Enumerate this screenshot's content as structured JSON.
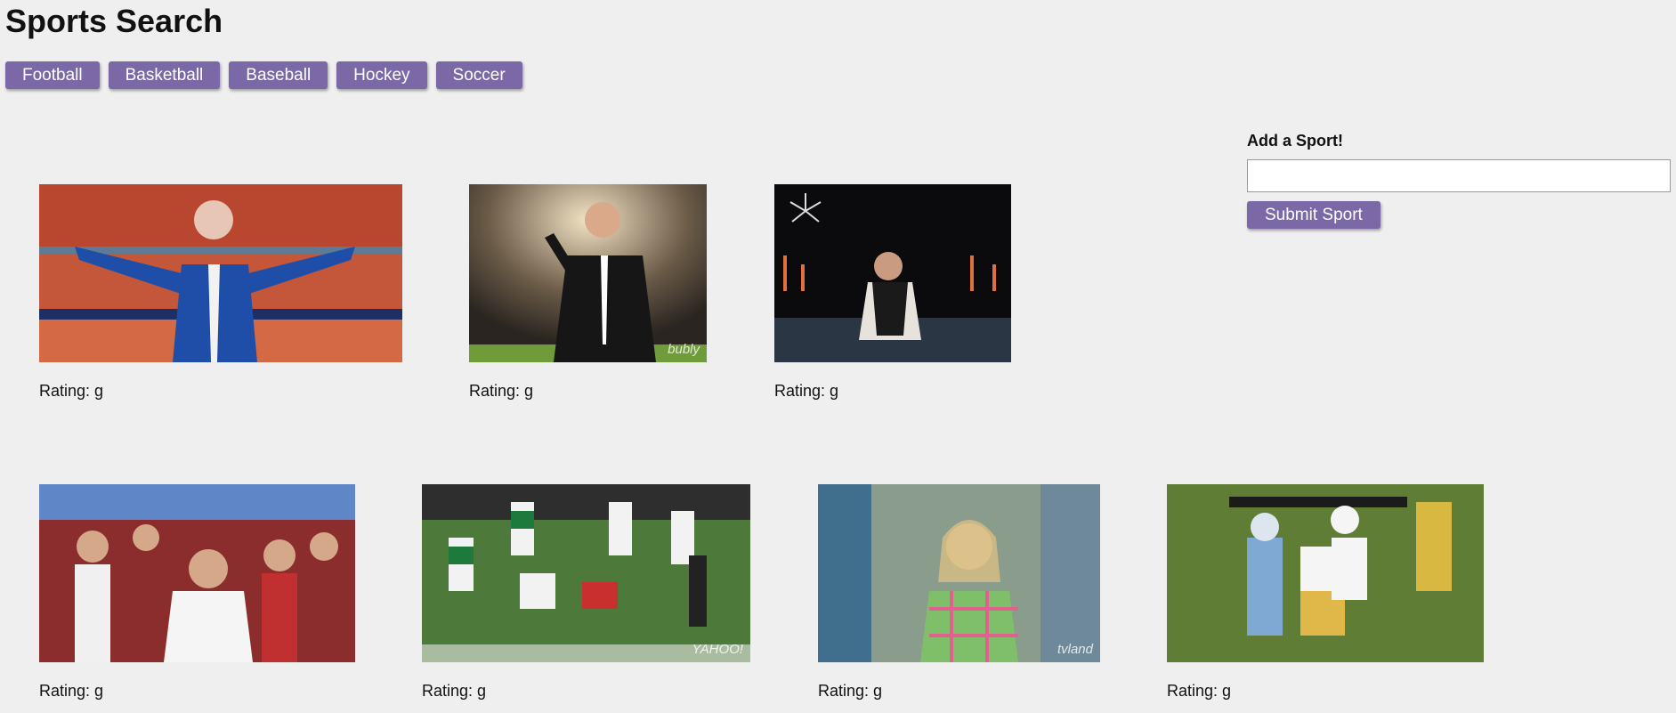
{
  "header": {
    "title": "Sports Search"
  },
  "sports": [
    "Football",
    "Basketball",
    "Baseball",
    "Hockey",
    "Soccer"
  ],
  "add_form": {
    "label": "Add a Sport!",
    "input_value": "",
    "submit_label": "Submit Sport"
  },
  "gifs": [
    {
      "icon": "man-in-blue-suit-stadium-gif",
      "rating_label": "Rating: g"
    },
    {
      "icon": "man-in-black-suit-stadium-gif",
      "rating_label": "Rating: g",
      "watermark": "bubly"
    },
    {
      "icon": "man-with-sunglasses-fireworks-gif",
      "rating_label": "Rating: g"
    },
    {
      "icon": "cheering-ohio-state-fans-gif",
      "rating_label": "Rating: g"
    },
    {
      "icon": "football-players-on-field-gif",
      "rating_label": "Rating: g",
      "watermark": "YAHOO!"
    },
    {
      "icon": "woman-in-plaid-shirt-gif",
      "rating_label": "Rating: g",
      "watermark": "tvland"
    },
    {
      "icon": "football-touchdown-celebration-gif",
      "rating_label": "Rating: g"
    }
  ],
  "colors": {
    "button_bg": "#7b68a6",
    "button_text": "#ffffff",
    "page_bg": "#efefef"
  }
}
